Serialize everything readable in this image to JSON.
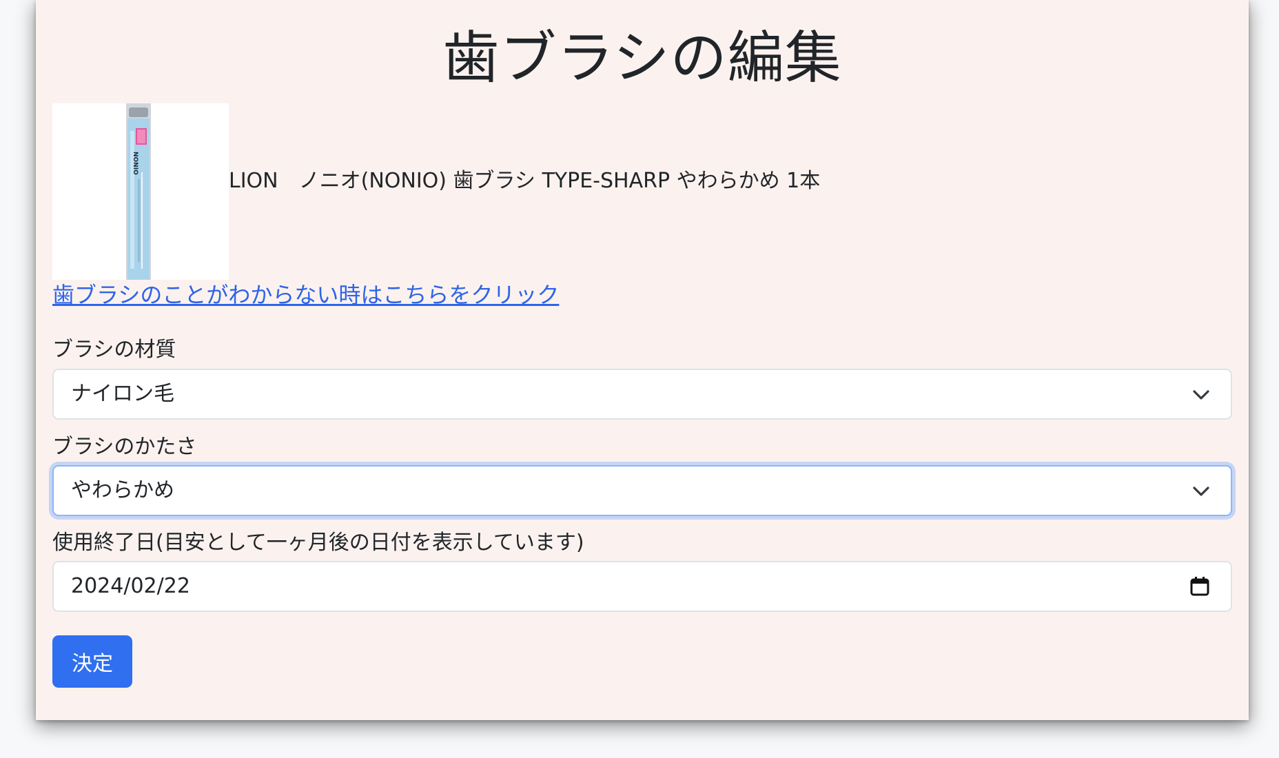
{
  "page": {
    "title": "歯ブラシの編集",
    "product_name": "LION　ノニオ(NONIO) 歯ブラシ TYPE-SHARP やわらかめ 1本",
    "help_link": "歯ブラシのことがわからない時はこちらをクリック"
  },
  "form": {
    "material": {
      "label": "ブラシの材質",
      "value": "ナイロン毛"
    },
    "hardness": {
      "label": "ブラシのかたさ",
      "value": "やわらかめ"
    },
    "end_date": {
      "label": "使用終了日(目安として一ヶ月後の日付を表示しています)",
      "value": "2024/02/22"
    },
    "submit_label": "決定"
  },
  "product_image": {
    "brand_text": "NONIO"
  },
  "colors": {
    "background": "#fbf2ef",
    "link": "#2f63e8",
    "button": "#2f6ff0",
    "focus_ring": "#86b7fe"
  },
  "icons": [
    "chevron-down-icon",
    "calendar-icon"
  ]
}
